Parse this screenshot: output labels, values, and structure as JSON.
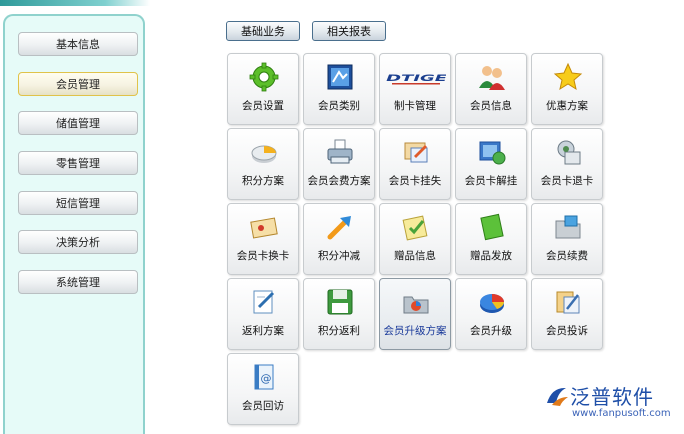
{
  "sidebar": {
    "items": [
      {
        "label": "基本信息"
      },
      {
        "label": "会员管理"
      },
      {
        "label": "储值管理"
      },
      {
        "label": "零售管理"
      },
      {
        "label": "短信管理"
      },
      {
        "label": "决策分析"
      },
      {
        "label": "系统管理"
      }
    ],
    "active_index": 1
  },
  "toolbar": {
    "basic_label": "基础业务",
    "reports_label": "相关报表"
  },
  "tiles": [
    {
      "label": "会员设置",
      "icon": "gear-icon"
    },
    {
      "label": "会员类别",
      "icon": "category-icon"
    },
    {
      "label": "制卡管理",
      "icon": "hdtiger-logo-icon",
      "icon_text": "HDTIGER"
    },
    {
      "label": "会员信息",
      "icon": "users-icon"
    },
    {
      "label": "优惠方案",
      "icon": "star-icon"
    },
    {
      "label": "积分方案",
      "icon": "pie-icon"
    },
    {
      "label": "会员会费方案",
      "icon": "printer-icon"
    },
    {
      "label": "会员卡挂失",
      "icon": "card-lost-icon"
    },
    {
      "label": "会员卡解挂",
      "icon": "card-unlock-icon"
    },
    {
      "label": "会员卡退卡",
      "icon": "card-return-icon"
    },
    {
      "label": "会员卡换卡",
      "icon": "card-swap-icon"
    },
    {
      "label": "积分冲减",
      "icon": "arrow-icon"
    },
    {
      "label": "赠品信息",
      "icon": "gift-note-icon"
    },
    {
      "label": "赠品发放",
      "icon": "green-book-icon"
    },
    {
      "label": "会员续费",
      "icon": "folder-icon"
    },
    {
      "label": "返利方案",
      "icon": "notebook-icon"
    },
    {
      "label": "积分返利",
      "icon": "floppy-icon"
    },
    {
      "label": "会员升级方案",
      "icon": "folder-chart-icon"
    },
    {
      "label": "会员升级",
      "icon": "pie3d-icon"
    },
    {
      "label": "会员投诉",
      "icon": "complaint-icon"
    },
    {
      "label": "会员回访",
      "icon": "email-book-icon"
    }
  ],
  "active_tile_index": 17,
  "brand": {
    "name": "泛普软件",
    "url": "www.fanpusoft.com"
  },
  "colors": {
    "sidebar_bg": "#e6fbf8",
    "sidebar_border": "#8fd2cd",
    "brand_blue": "#1f4fa8"
  }
}
